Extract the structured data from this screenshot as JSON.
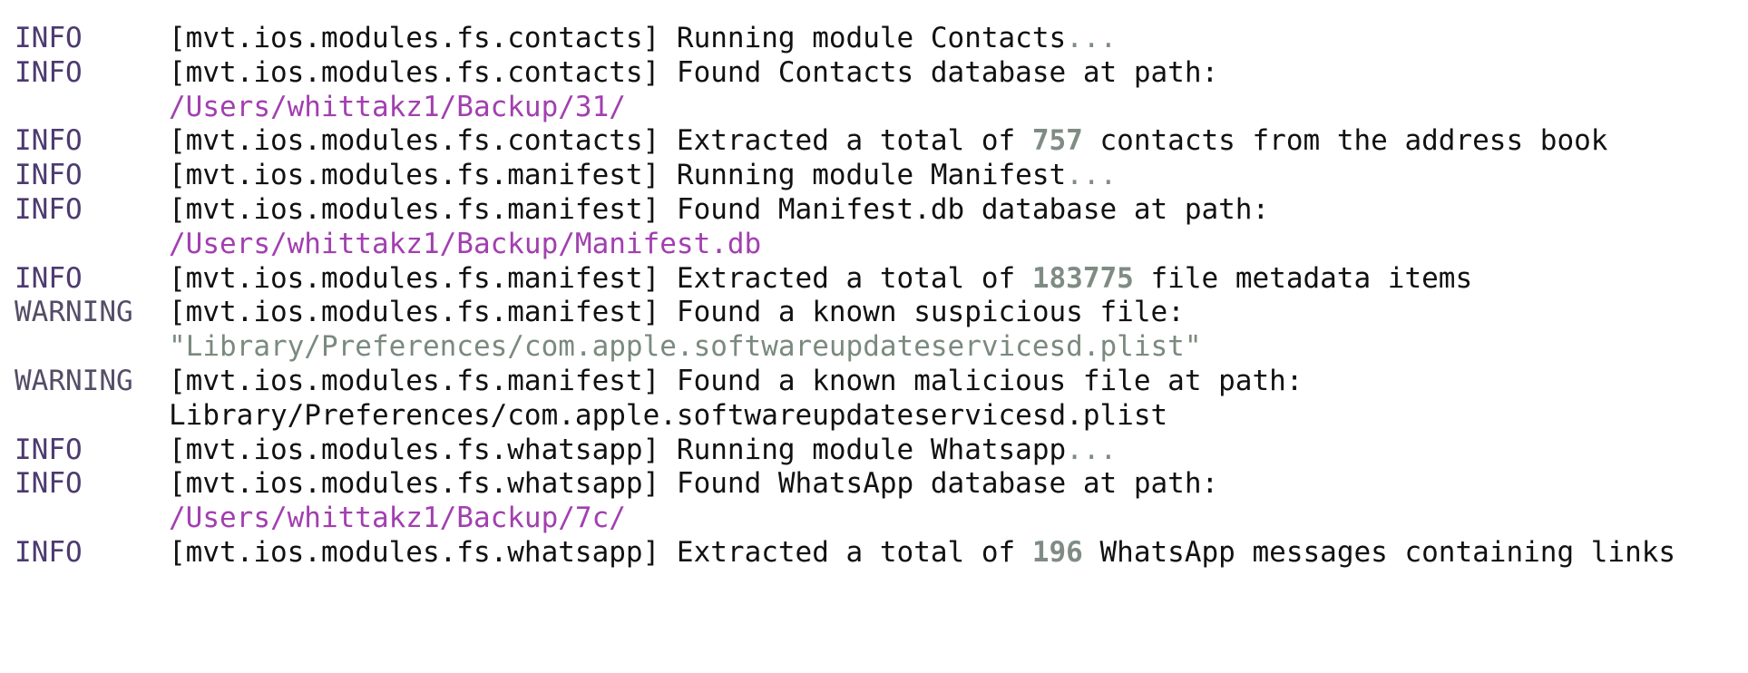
{
  "lines": [
    {
      "level": "INFO",
      "logger": "[mvt.ios.modules.fs.contacts]",
      "text": " Running module Contacts",
      "dots": "..."
    },
    {
      "level": "INFO",
      "logger": "[mvt.ios.modules.fs.contacts]",
      "text": " Found Contacts database at path:"
    },
    {
      "path": "/Users/whittakz1/Backup/31/"
    },
    {
      "level": "INFO",
      "logger": "[mvt.ios.modules.fs.contacts]",
      "pre": " Extracted a total of ",
      "num": "757",
      "post": " contacts from the address book"
    },
    {
      "level": "INFO",
      "logger": "[mvt.ios.modules.fs.manifest]",
      "text": " Running module Manifest",
      "dots": "..."
    },
    {
      "level": "INFO",
      "logger": "[mvt.ios.modules.fs.manifest]",
      "text": " Found Manifest.db database at path:"
    },
    {
      "path": "/Users/whittakz1/Backup/Manifest.db"
    },
    {
      "level": "INFO",
      "logger": "[mvt.ios.modules.fs.manifest]",
      "pre": " Extracted a total of ",
      "num": "183775",
      "post": " file metadata items"
    },
    {
      "level": "WARNING",
      "logger": "[mvt.ios.modules.fs.manifest]",
      "text": " Found a known suspicious file:"
    },
    {
      "quoted": "\"Library/Preferences/com.apple.softwareupdateservicesd.plist\""
    },
    {
      "level": "WARNING",
      "logger": "[mvt.ios.modules.fs.manifest]",
      "text": " Found a known malicious file at path:"
    },
    {
      "plain": "Library/Preferences/com.apple.softwareupdateservicesd.plist"
    },
    {
      "level": "INFO",
      "logger": "[mvt.ios.modules.fs.whatsapp]",
      "text": " Running module Whatsapp",
      "dots": "..."
    },
    {
      "level": "INFO",
      "logger": "[mvt.ios.modules.fs.whatsapp]",
      "text": " Found WhatsApp database at path:"
    },
    {
      "path": "/Users/whittakz1/Backup/7c/"
    },
    {
      "level": "INFO",
      "logger": "[mvt.ios.modules.fs.whatsapp]",
      "pre": " Extracted a total of ",
      "num": "196",
      "post": " WhatsApp messages containing links"
    }
  ],
  "colors": {
    "info": "#4d3a70",
    "warning": "#544d66",
    "path": "#a23fb0",
    "number": "#7f8c84",
    "quoted": "#7a8a7e",
    "text": "#111111",
    "background": "#ffffff"
  }
}
